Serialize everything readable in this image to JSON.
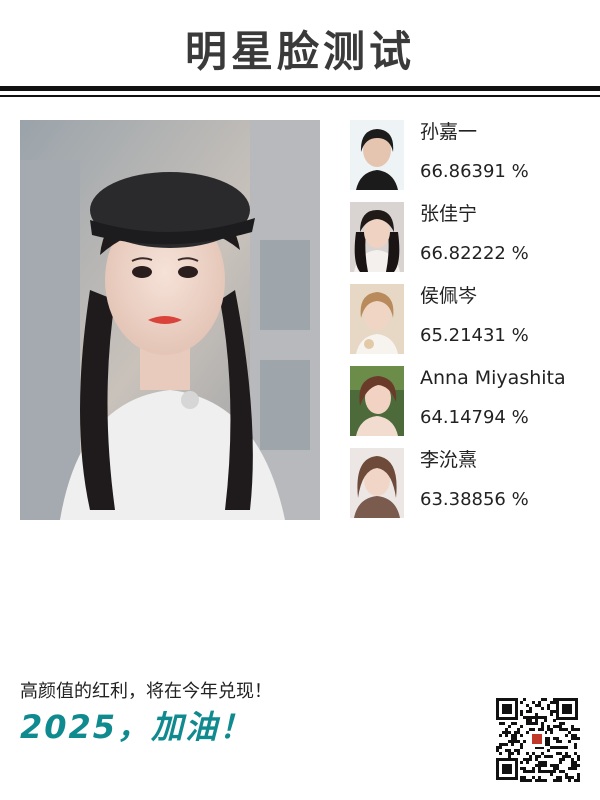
{
  "header": {
    "title": "明星脸测试"
  },
  "results": [
    {
      "name": "孙嘉一",
      "score": "66.86391 %"
    },
    {
      "name": "张佳宁",
      "score": "66.82222 %"
    },
    {
      "name": "侯佩岑",
      "score": "65.21431 %"
    },
    {
      "name": "Anna Miyashita",
      "score": "64.14794 %"
    },
    {
      "name": "李沇熹",
      "score": "63.38856 %"
    }
  ],
  "footer": {
    "slogan": "高颜值的红利，将在今年兑现！",
    "cheer": "2025，加油！"
  },
  "colors": {
    "accent": "#0f8a8f",
    "rule": "#111111"
  },
  "icons": {
    "qr": "qr-code-icon"
  }
}
